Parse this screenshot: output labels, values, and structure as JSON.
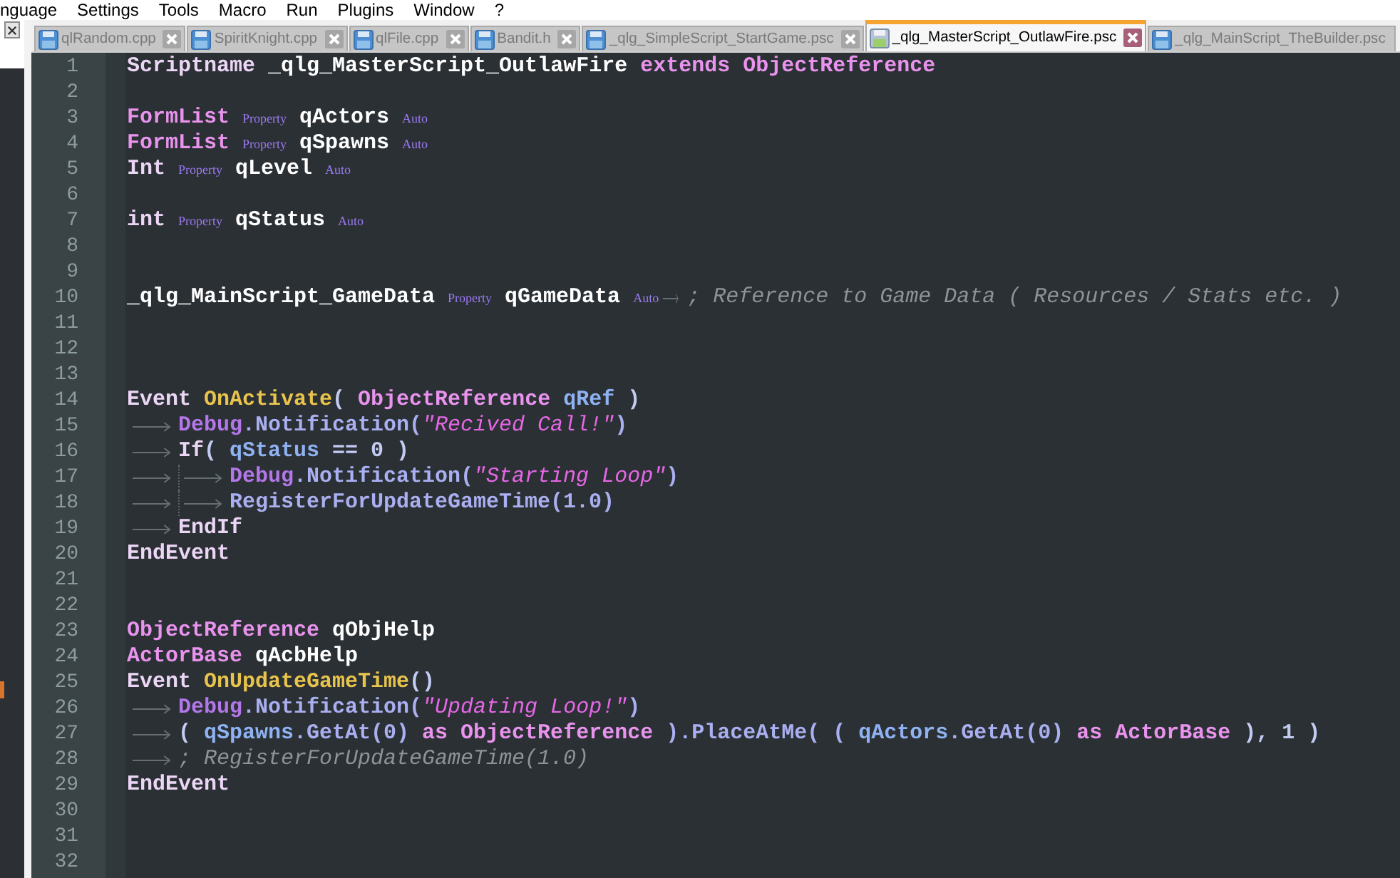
{
  "menu": [
    "nguage",
    "Settings",
    "Tools",
    "Macro",
    "Run",
    "Plugins",
    "Window",
    "?"
  ],
  "tabs": [
    {
      "label": "qlRandom.cpp",
      "selected": false,
      "close_button": true
    },
    {
      "label": "SpiritKnight.cpp",
      "selected": false,
      "close_button": true
    },
    {
      "label": "qlFile.cpp",
      "selected": false,
      "close_button": true
    },
    {
      "label": "Bandit.h",
      "selected": false,
      "close_button": true
    },
    {
      "label": "_qlg_SimpleScript_StartGame.psc",
      "selected": false,
      "close_button": true
    },
    {
      "label": "_qlg_MasterScript_OutlawFire.psc",
      "selected": true,
      "close_button": true
    },
    {
      "label": "_qlg_MainScript_TheBuilder.psc",
      "selected": false,
      "close_button": false
    }
  ],
  "editor": {
    "lines": [
      {
        "number": "1",
        "segments": [
          {
            "kind": "code",
            "tokens": [
              {
                "kind": "keyword",
                "text": "Scriptname "
              },
              {
                "kind": "identifier",
                "text": "_qlg_MasterScript_OutlawFire "
              },
              {
                "kind": "type",
                "text": "extends ObjectReference"
              }
            ]
          }
        ]
      },
      {
        "number": "2"
      },
      {
        "number": "3",
        "segments": [
          {
            "kind": "code",
            "tokens": [
              {
                "kind": "type",
                "text": "FormList "
              },
              {
                "kind": "property",
                "text": "Property"
              },
              {
                "kind": "identifier",
                "text": " qActors "
              },
              {
                "kind": "property",
                "text": "Auto"
              }
            ]
          }
        ]
      },
      {
        "number": "4",
        "segments": [
          {
            "kind": "code",
            "tokens": [
              {
                "kind": "type",
                "text": "FormList "
              },
              {
                "kind": "property",
                "text": "Property"
              },
              {
                "kind": "identifier",
                "text": " qSpawns "
              },
              {
                "kind": "property",
                "text": "Auto"
              }
            ]
          }
        ]
      },
      {
        "number": "5",
        "segments": [
          {
            "kind": "code",
            "tokens": [
              {
                "kind": "keyword",
                "text": "Int "
              },
              {
                "kind": "property",
                "text": "Property"
              },
              {
                "kind": "identifier",
                "text": " qLevel "
              },
              {
                "kind": "property",
                "text": "Auto"
              }
            ]
          }
        ]
      },
      {
        "number": "6"
      },
      {
        "number": "7",
        "segments": [
          {
            "kind": "code",
            "tokens": [
              {
                "kind": "keyword",
                "text": "int "
              },
              {
                "kind": "property",
                "text": "Property"
              },
              {
                "kind": "identifier",
                "text": " qStatus "
              },
              {
                "kind": "property",
                "text": "Auto"
              }
            ]
          }
        ]
      },
      {
        "number": "8"
      },
      {
        "number": "9"
      },
      {
        "number": "10",
        "segments": [
          {
            "kind": "code",
            "tokens": [
              {
                "kind": "identifier",
                "text": "_qlg_MainScript_GameData "
              },
              {
                "kind": "property",
                "text": "Property"
              },
              {
                "kind": "identifier",
                "text": " qGameData "
              },
              {
                "kind": "property",
                "text": "Auto"
              }
            ]
          },
          {
            "kind": "tab"
          },
          {
            "kind": "code",
            "tokens": [
              {
                "kind": "comment",
                "text": "; Reference to Game Data ( Resources / Stats etc. )"
              }
            ]
          }
        ]
      },
      {
        "number": "11"
      },
      {
        "number": "12"
      },
      {
        "number": "13"
      },
      {
        "number": "14",
        "segments": [
          {
            "kind": "code",
            "tokens": [
              {
                "kind": "keyword",
                "text": "Event "
              },
              {
                "kind": "event",
                "text": "OnActivate"
              },
              {
                "kind": "plain",
                "text": "( "
              },
              {
                "kind": "type",
                "text": "ObjectReference "
              },
              {
                "kind": "variable",
                "text": "qRef "
              },
              {
                "kind": "plain",
                "text": ")"
              }
            ]
          }
        ]
      },
      {
        "number": "15",
        "segments": [
          {
            "kind": "tab"
          },
          {
            "kind": "code",
            "tokens": [
              {
                "kind": "object",
                "text": "Debug"
              },
              {
                "kind": "call",
                "text": ".Notification("
              },
              {
                "kind": "string",
                "text": "\"Recived Call!\""
              },
              {
                "kind": "call",
                "text": ")"
              }
            ]
          }
        ]
      },
      {
        "number": "16",
        "segments": [
          {
            "kind": "tab"
          },
          {
            "kind": "code",
            "tokens": [
              {
                "kind": "keyword",
                "text": "If"
              },
              {
                "kind": "plain",
                "text": "( "
              },
              {
                "kind": "variable",
                "text": "qStatus "
              },
              {
                "kind": "plain",
                "text": "== 0 )"
              }
            ]
          }
        ]
      },
      {
        "number": "17",
        "segments": [
          {
            "kind": "tab"
          },
          {
            "kind": "tab"
          },
          {
            "kind": "code",
            "tokens": [
              {
                "kind": "object",
                "text": "Debug"
              },
              {
                "kind": "call",
                "text": ".Notification("
              },
              {
                "kind": "string",
                "text": "\"Starting Loop\""
              },
              {
                "kind": "call",
                "text": ")"
              }
            ]
          }
        ]
      },
      {
        "number": "18",
        "segments": [
          {
            "kind": "tab"
          },
          {
            "kind": "tab"
          },
          {
            "kind": "code",
            "tokens": [
              {
                "kind": "call",
                "text": "RegisterForUpdateGameTime(1.0)"
              }
            ]
          }
        ]
      },
      {
        "number": "19",
        "segments": [
          {
            "kind": "tab"
          },
          {
            "kind": "code",
            "tokens": [
              {
                "kind": "keyword",
                "text": "EndIf"
              }
            ]
          }
        ]
      },
      {
        "number": "20",
        "segments": [
          {
            "kind": "code",
            "tokens": [
              {
                "kind": "keyword",
                "text": "EndEvent"
              }
            ]
          }
        ]
      },
      {
        "number": "21"
      },
      {
        "number": "22"
      },
      {
        "number": "23",
        "segments": [
          {
            "kind": "code",
            "tokens": [
              {
                "kind": "type",
                "text": "ObjectReference "
              },
              {
                "kind": "identifier",
                "text": "qObjHelp"
              }
            ]
          }
        ]
      },
      {
        "number": "24",
        "segments": [
          {
            "kind": "code",
            "tokens": [
              {
                "kind": "type",
                "text": "ActorBase "
              },
              {
                "kind": "identifier",
                "text": "qAcbHelp"
              }
            ]
          }
        ]
      },
      {
        "number": "25",
        "segments": [
          {
            "kind": "code",
            "tokens": [
              {
                "kind": "keyword",
                "text": "Event "
              },
              {
                "kind": "event",
                "text": "OnUpdateGameTime"
              },
              {
                "kind": "plain",
                "text": "()"
              }
            ]
          }
        ]
      },
      {
        "number": "26",
        "segments": [
          {
            "kind": "tab"
          },
          {
            "kind": "code",
            "tokens": [
              {
                "kind": "object",
                "text": "Debug"
              },
              {
                "kind": "call",
                "text": ".Notification("
              },
              {
                "kind": "string",
                "text": "\"Updating Loop!\""
              },
              {
                "kind": "call",
                "text": ")"
              }
            ]
          }
        ]
      },
      {
        "number": "27",
        "segments": [
          {
            "kind": "tab"
          },
          {
            "kind": "code",
            "tokens": [
              {
                "kind": "plain",
                "text": "( "
              },
              {
                "kind": "variable",
                "text": "qSpawns"
              },
              {
                "kind": "call",
                "text": ".GetAt(0) "
              },
              {
                "kind": "type",
                "text": "as ObjectReference "
              },
              {
                "kind": "call",
                "text": ").PlaceAtMe( ( "
              },
              {
                "kind": "variable",
                "text": "qActors"
              },
              {
                "kind": "call",
                "text": ".GetAt(0) "
              },
              {
                "kind": "type",
                "text": "as ActorBase "
              },
              {
                "kind": "plain",
                "text": "), 1 )"
              }
            ]
          }
        ]
      },
      {
        "number": "28",
        "segments": [
          {
            "kind": "tab"
          },
          {
            "kind": "code",
            "tokens": [
              {
                "kind": "comment",
                "text": "; RegisterForUpdateGameTime(1.0)"
              }
            ]
          }
        ]
      },
      {
        "number": "29",
        "segments": [
          {
            "kind": "code",
            "tokens": [
              {
                "kind": "keyword",
                "text": "EndEvent"
              }
            ]
          }
        ]
      },
      {
        "number": "30"
      },
      {
        "number": "31"
      },
      {
        "number": "32"
      }
    ]
  }
}
